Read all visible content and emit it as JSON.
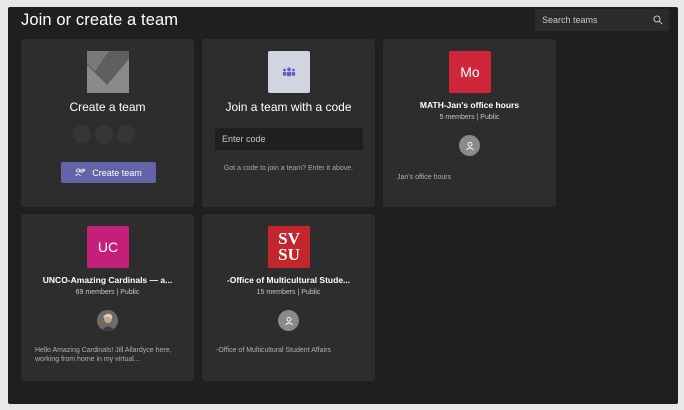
{
  "header": {
    "title": "Join or create a team",
    "search_placeholder": "Search teams"
  },
  "create_card": {
    "title": "Create a team",
    "button_label": "Create team"
  },
  "join_card": {
    "title": "Join a team with a code",
    "input_placeholder": "Enter code",
    "hint": "Got a code to join a team? Enter it above."
  },
  "teams": [
    {
      "avatar_text": "Mo",
      "avatar_color": "#d0263c",
      "name": "MATH-Jan's office hours",
      "meta": "5 members | Public",
      "description": "Jan's office hours"
    },
    {
      "avatar_text": "UC",
      "avatar_color": "#c4207a",
      "name": "UNCO-Amazing Cardinals — a...",
      "meta": "69 members | Public",
      "description": "Hello Amazing Cardinals! Jill Allardyce here, working from home in my virtual..."
    },
    {
      "avatar_text": "SV SU",
      "avatar_color": "#c1272d",
      "name": "-Office of Multicultural Stude...",
      "meta": "15 members | Public",
      "description": "-Office of Multicultural Student Affairs"
    }
  ],
  "colors": {
    "accent": "#6264a7",
    "background": "#1f1f1f",
    "card": "#2d2d2d"
  }
}
